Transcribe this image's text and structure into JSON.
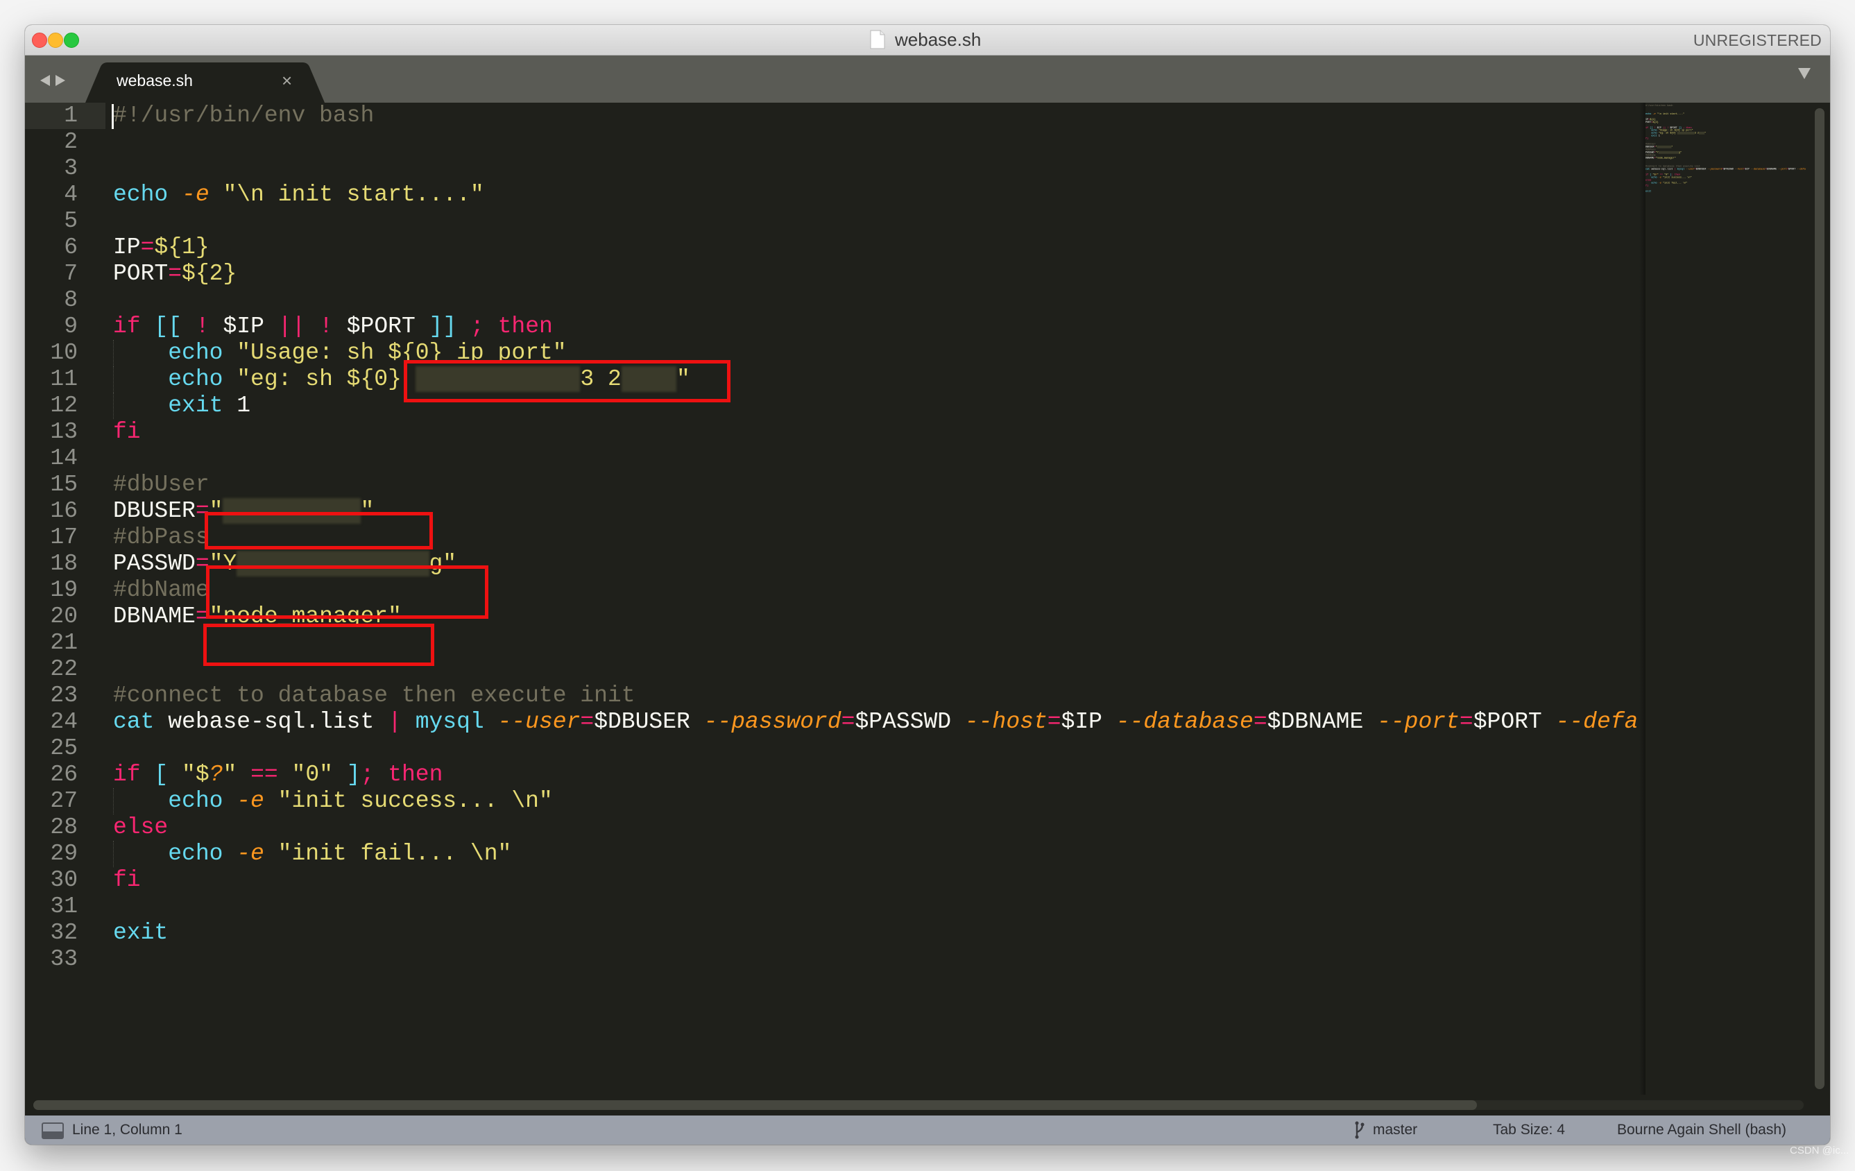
{
  "window": {
    "title": "webase.sh",
    "title_icon": "document-icon",
    "registration_label": "UNREGISTERED",
    "traffic_lights": {
      "close": "#fe5f57",
      "minimize": "#febc2e",
      "maximize": "#28c840"
    }
  },
  "tabbar": {
    "nav_icons": [
      "arrow-left-icon",
      "arrow-right-icon"
    ],
    "tabs": [
      {
        "label": "webase.sh",
        "active": true,
        "close_label": "×"
      }
    ],
    "dropdown_icon": "chevron-down-icon"
  },
  "theme": {
    "editor_bg": "#1f201b",
    "plain": "#f8f8f2",
    "comment": "#75715e",
    "keyword": "#f92672",
    "builtin": "#66d9ef",
    "string": "#e6db74",
    "flag": "#fd971f",
    "annotation_box": "#ee1111",
    "status_bar_bg": "#9ca1ab"
  },
  "editor": {
    "current_line": 1,
    "lines": [
      [
        [
          "#!/usr/bin/env bash",
          "comment"
        ]
      ],
      [],
      [],
      [
        [
          "echo",
          "builtin"
        ],
        [
          " ",
          "plain"
        ],
        [
          "-e",
          "flag"
        ],
        [
          " ",
          "plain"
        ],
        [
          "\"\\n init start....\"",
          "string"
        ]
      ],
      [],
      [
        [
          "IP",
          "plain"
        ],
        [
          "=",
          "op"
        ],
        [
          "${1}",
          "string"
        ]
      ],
      [
        [
          "PORT",
          "plain"
        ],
        [
          "=",
          "op"
        ],
        [
          "${2}",
          "string"
        ]
      ],
      [],
      [
        [
          "if",
          "keyword"
        ],
        [
          " ",
          "plain"
        ],
        [
          "[[",
          "bracket"
        ],
        [
          " ",
          "plain"
        ],
        [
          "!",
          "op"
        ],
        [
          " $IP ",
          "plain"
        ],
        [
          "||",
          "op"
        ],
        [
          " ",
          "plain"
        ],
        [
          "!",
          "op"
        ],
        [
          " $PORT ",
          "plain"
        ],
        [
          "]]",
          "bracket"
        ],
        [
          " ",
          "plain"
        ],
        [
          ";",
          "op"
        ],
        [
          " ",
          "plain"
        ],
        [
          "then",
          "keyword"
        ]
      ],
      [
        [
          "    ",
          "plain"
        ],
        [
          "echo",
          "builtin"
        ],
        [
          " ",
          "plain"
        ],
        [
          "\"Usage: sh ${0} ip port\"",
          "string"
        ]
      ],
      [
        [
          "    ",
          "plain"
        ],
        [
          "echo",
          "builtin"
        ],
        [
          " ",
          "plain"
        ],
        [
          "\"eg: sh ${0} ",
          "string"
        ],
        [
          "############",
          "redacted"
        ],
        [
          "3 2",
          "string"
        ],
        [
          "####",
          "redacted"
        ],
        [
          "\"",
          "string"
        ]
      ],
      [
        [
          "    ",
          "plain"
        ],
        [
          "exit",
          "builtin"
        ],
        [
          " 1",
          "plain"
        ]
      ],
      [
        [
          "fi",
          "keyword"
        ]
      ],
      [],
      [
        [
          "#dbUser",
          "comment"
        ]
      ],
      [
        [
          "DBUSER",
          "plain"
        ],
        [
          "=",
          "op"
        ],
        [
          "\"",
          "string"
        ],
        [
          "##########",
          "redacted"
        ],
        [
          "\"",
          "string"
        ]
      ],
      [
        [
          "#dbPass",
          "comment"
        ]
      ],
      [
        [
          "PASSWD",
          "plain"
        ],
        [
          "=",
          "op"
        ],
        [
          "\"Y",
          "string"
        ],
        [
          "##############",
          "redacted"
        ],
        [
          "g\"",
          "string"
        ]
      ],
      [
        [
          "#dbName",
          "comment"
        ]
      ],
      [
        [
          "DBNAME",
          "plain"
        ],
        [
          "=",
          "op"
        ],
        [
          "\"node_manager\"",
          "string"
        ]
      ],
      [],
      [],
      [
        [
          "#connect to database then execute init",
          "comment"
        ]
      ],
      [
        [
          "cat",
          "builtin"
        ],
        [
          " webase-sql.list ",
          "plain"
        ],
        [
          "|",
          "op"
        ],
        [
          " ",
          "plain"
        ],
        [
          "mysql",
          "builtin"
        ],
        [
          " ",
          "plain"
        ],
        [
          "--user",
          "flag"
        ],
        [
          "=",
          "op"
        ],
        [
          "$DBUSER ",
          "plain"
        ],
        [
          "--password",
          "flag"
        ],
        [
          "=",
          "op"
        ],
        [
          "$PASSWD ",
          "plain"
        ],
        [
          "--host",
          "flag"
        ],
        [
          "=",
          "op"
        ],
        [
          "$IP ",
          "plain"
        ],
        [
          "--database",
          "flag"
        ],
        [
          "=",
          "op"
        ],
        [
          "$DBNAME ",
          "plain"
        ],
        [
          "--port",
          "flag"
        ],
        [
          "=",
          "op"
        ],
        [
          "$PORT ",
          "plain"
        ],
        [
          "--defa",
          "flag"
        ]
      ],
      [],
      [
        [
          "if",
          "keyword"
        ],
        [
          " ",
          "plain"
        ],
        [
          "[",
          "bracket"
        ],
        [
          " ",
          "plain"
        ],
        [
          "\"$",
          "string"
        ],
        [
          "?",
          "flag"
        ],
        [
          "\"",
          "string"
        ],
        [
          " ",
          "plain"
        ],
        [
          "==",
          "op"
        ],
        [
          " ",
          "plain"
        ],
        [
          "\"0\"",
          "string"
        ],
        [
          " ",
          "plain"
        ],
        [
          "]",
          "bracket"
        ],
        [
          ";",
          "op"
        ],
        [
          " ",
          "plain"
        ],
        [
          "then",
          "keyword"
        ]
      ],
      [
        [
          "    ",
          "plain"
        ],
        [
          "echo",
          "builtin"
        ],
        [
          " ",
          "plain"
        ],
        [
          "-e",
          "flag"
        ],
        [
          " ",
          "plain"
        ],
        [
          "\"init success... \\n\"",
          "string"
        ]
      ],
      [
        [
          "else",
          "keyword"
        ]
      ],
      [
        [
          "    ",
          "plain"
        ],
        [
          "echo",
          "builtin"
        ],
        [
          " ",
          "plain"
        ],
        [
          "-e",
          "flag"
        ],
        [
          " ",
          "plain"
        ],
        [
          "\"init fail... \\n\"",
          "string"
        ]
      ],
      [
        [
          "fi",
          "keyword"
        ]
      ],
      [],
      [
        [
          "exit",
          "builtin"
        ]
      ],
      []
    ],
    "indent_guide_lines": [
      10,
      11,
      12,
      27,
      29
    ],
    "annotations": [
      {
        "label": "redacted-ip-port-box",
        "line": 11
      },
      {
        "label": "dbuser-box",
        "line": 16
      },
      {
        "label": "passwd-box",
        "line": 18
      },
      {
        "label": "dbname-box",
        "line": 20
      }
    ]
  },
  "statusbar": {
    "panel_icon": "panel-toggle-icon",
    "position": "Line 1, Column 1",
    "branch_icon": "git-branch-icon",
    "branch": "master",
    "tab_size": "Tab Size: 4",
    "syntax": "Bourne Again Shell (bash)"
  },
  "watermark": "CSDN @ic..."
}
